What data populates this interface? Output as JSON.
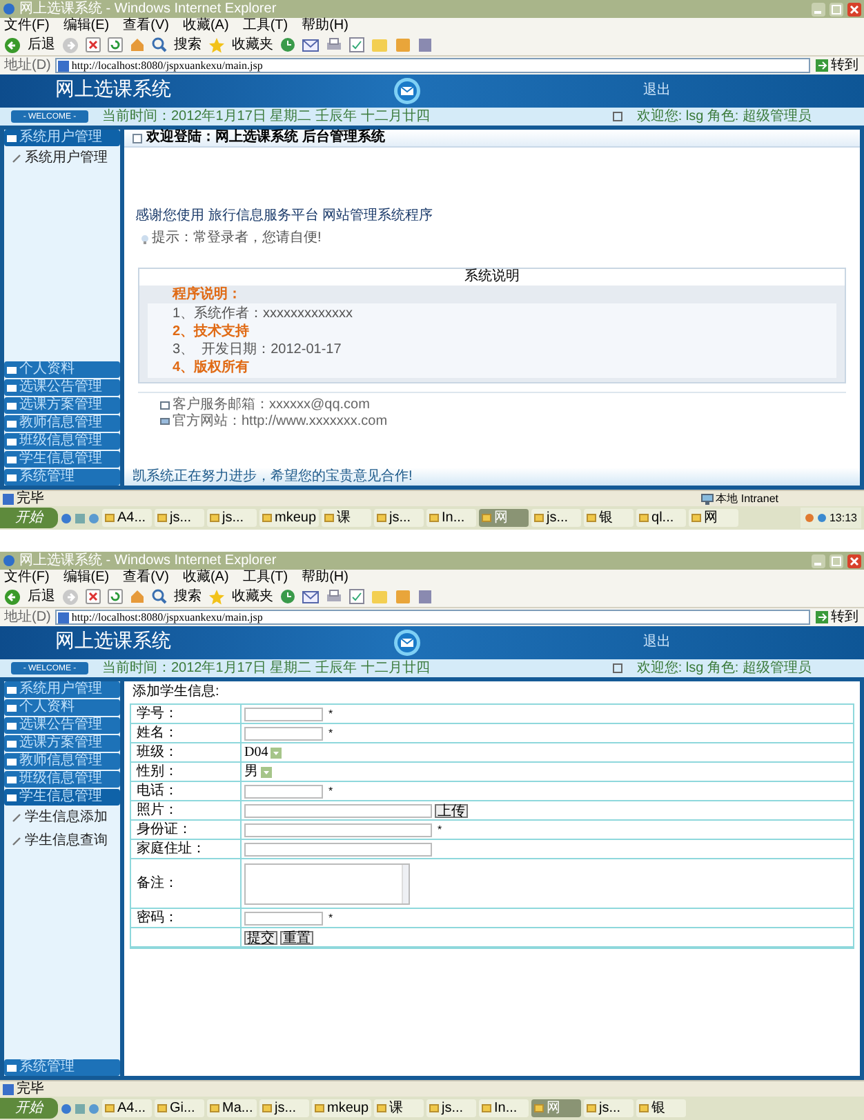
{
  "windows": [
    {
      "title": "网上选课系统 - Windows Internet Explorer",
      "menu": [
        "文件(F)",
        "编辑(E)",
        "查看(V)",
        "收藏(A)",
        "工具(T)",
        "帮助(H)"
      ],
      "toolbar": {
        "back": "后退",
        "search": "搜索",
        "favorites": "收藏夹"
      },
      "address": {
        "label": "地址(D)",
        "url": "http://localhost:8080/jspxuankexu/main.jsp",
        "go": "转到"
      },
      "banner": {
        "title": "网上选课系统",
        "logout": "退出"
      },
      "welcome": {
        "badge": "- WELCOME -",
        "time": "当前时间：2012年1月17日 星期二 壬辰年 十二月廿四",
        "user": "欢迎您: lsg 角色: 超级管理员"
      },
      "sidebar": [
        {
          "label": "系统用户管理",
          "expanded": true,
          "items": [
            "系统用户管理"
          ]
        },
        {
          "label": "个人资料",
          "expanded": false
        },
        {
          "label": "选课公告管理",
          "expanded": false
        },
        {
          "label": "选课方案管理",
          "expanded": false
        },
        {
          "label": "教师信息管理",
          "expanded": false
        },
        {
          "label": "班级信息管理",
          "expanded": false
        },
        {
          "label": "学生信息管理",
          "expanded": false
        },
        {
          "label": "系统管理",
          "expanded": false
        }
      ],
      "content": {
        "kind": "home",
        "breadcrumb": "欢迎登陆：网上选课系统 后台管理系统",
        "thanks": "感谢您使用 旅行信息服务平台 网站管理系统程序",
        "tip": "提示：常登录者，您请自便!",
        "box_title": "系统说明",
        "notes_heading": "程序说明：",
        "notes": [
          {
            "text": "1、系统作者：xxxxxxxxxxxxx",
            "highlight": false
          },
          {
            "text": "2、技术支持",
            "highlight": true
          },
          {
            "text": "3、  开发日期：2012-01-17",
            "highlight": false
          },
          {
            "text": "4、版权所有",
            "highlight": true
          }
        ],
        "contacts": [
          "客户服务邮箱：xxxxxx@qq.com",
          "官方网站：http://www.xxxxxxx.com"
        ],
        "footer": "凯系统正在努力进步，希望您的宝贵意见合作!"
      },
      "status": {
        "text": "完毕",
        "zone": "本地 Intranet"
      },
      "taskbar": {
        "start": "开始",
        "items": [
          {
            "label": "A4...",
            "selected": false
          },
          {
            "label": "js...",
            "selected": false
          },
          {
            "label": "js...",
            "selected": false
          },
          {
            "label": "mkeup",
            "selected": false
          },
          {
            "label": "课",
            "selected": false
          },
          {
            "label": "js...",
            "selected": false
          },
          {
            "label": "In...",
            "selected": false
          },
          {
            "label": "网",
            "selected": true
          },
          {
            "label": "js...",
            "selected": false
          },
          {
            "label": "银",
            "selected": false
          },
          {
            "label": "ql...",
            "selected": false
          },
          {
            "label": "网",
            "selected": false
          }
        ],
        "clock": "13:13"
      }
    },
    {
      "title": "网上选课系统 - Windows Internet Explorer",
      "menu": [
        "文件(F)",
        "编辑(E)",
        "查看(V)",
        "收藏(A)",
        "工具(T)",
        "帮助(H)"
      ],
      "toolbar": {
        "back": "后退",
        "search": "搜索",
        "favorites": "收藏夹"
      },
      "address": {
        "label": "地址(D)",
        "url": "http://localhost:8080/jspxuankexu/main.jsp",
        "go": "转到"
      },
      "banner": {
        "title": "网上选课系统",
        "logout": "退出"
      },
      "welcome": {
        "badge": "- WELCOME -",
        "time": "当前时间：2012年1月17日 星期二 壬辰年 十二月廿四",
        "user": "欢迎您: lsg 角色: 超级管理员"
      },
      "sidebar": [
        {
          "label": "系统用户管理",
          "expanded": false
        },
        {
          "label": "个人资料",
          "expanded": false
        },
        {
          "label": "选课公告管理",
          "expanded": false
        },
        {
          "label": "选课方案管理",
          "expanded": false
        },
        {
          "label": "教师信息管理",
          "expanded": false
        },
        {
          "label": "班级信息管理",
          "expanded": false
        },
        {
          "label": "学生信息管理",
          "expanded": true,
          "items": [
            "学生信息添加",
            "学生信息查询"
          ]
        },
        {
          "label": "系统管理",
          "expanded": false
        }
      ],
      "content": {
        "kind": "form",
        "heading": "添加学生信息:",
        "fields": [
          {
            "label": "学号：",
            "kind": "text",
            "mark": "*"
          },
          {
            "label": "姓名：",
            "kind": "text",
            "mark": "*"
          },
          {
            "label": "班级：",
            "kind": "select",
            "value": "D04"
          },
          {
            "label": "性别：",
            "kind": "select",
            "value": "男"
          },
          {
            "label": "电话：",
            "kind": "text",
            "mark": "*"
          },
          {
            "label": "照片：",
            "kind": "file",
            "button": "上传"
          },
          {
            "label": "身份证：",
            "kind": "wide",
            "mark": "*"
          },
          {
            "label": "家庭住址：",
            "kind": "wide"
          },
          {
            "label": "备注：",
            "kind": "textarea"
          },
          {
            "label": "密码：",
            "kind": "text",
            "mark": "*"
          }
        ],
        "buttons": [
          "提交",
          "重置"
        ]
      },
      "status": {
        "text": "完毕"
      },
      "taskbar": {
        "start": "开始",
        "items": [
          {
            "label": "A4...",
            "selected": false
          },
          {
            "label": "Gi...",
            "selected": false
          },
          {
            "label": "Ma...",
            "selected": false
          },
          {
            "label": "js...",
            "selected": false
          },
          {
            "label": "mkeup",
            "selected": false
          },
          {
            "label": "课",
            "selected": false
          },
          {
            "label": "js...",
            "selected": false
          },
          {
            "label": "In...",
            "selected": false
          },
          {
            "label": "网",
            "selected": true
          },
          {
            "label": "js...",
            "selected": false
          },
          {
            "label": "银",
            "selected": false
          }
        ]
      }
    }
  ]
}
